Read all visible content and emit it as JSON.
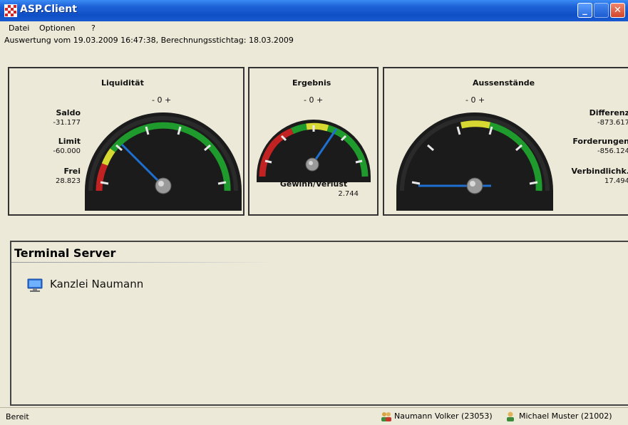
{
  "window": {
    "title": "ASP.Client"
  },
  "titlebar": {
    "minimize": "_",
    "close": "✕"
  },
  "menu": [
    "Datei",
    "Optionen",
    "?"
  ],
  "info_line": "Auswertung vom 19.03.2009 16:47:38, Berechnungsstichtag: 18.03.2009",
  "gauges": {
    "liquiditaet": {
      "title": "Liquidität",
      "scale_marker": "- 0 +",
      "saldo_label": "Saldo",
      "saldo_value": "-31.177",
      "limit_label": "Limit",
      "limit_value": "-60.000",
      "frei_label": "Frei",
      "frei_value": "28.823"
    },
    "ergebnis": {
      "title": "Ergebnis",
      "scale_marker": "- 0 +",
      "gewinn_label": "Gewinn/Verlust",
      "gewinn_value": "2.744"
    },
    "aussenstaende": {
      "title": "Aussenstände",
      "scale_marker": "- 0 +",
      "differenz_label": "Differenz",
      "differenz_value": "-873.617",
      "forderungen_label": "Forderungen",
      "forderungen_value": "-856.124",
      "verbindlich_label": "Verbindlichk.",
      "verbindlich_value": "17.494"
    }
  },
  "colors": {
    "gauge_green": "#1f9a2c",
    "gauge_yellow": "#d8d832",
    "gauge_red": "#c22222",
    "needle": "#1f6fd0"
  },
  "terminal_server": {
    "header": "Terminal Server",
    "items": [
      {
        "label": "Kanzlei Naumann",
        "icon": "monitor-icon"
      }
    ]
  },
  "status": {
    "text": "Bereit",
    "user1": "Naumann Volker (23053)",
    "user2": "Michael Muster (21002)"
  }
}
